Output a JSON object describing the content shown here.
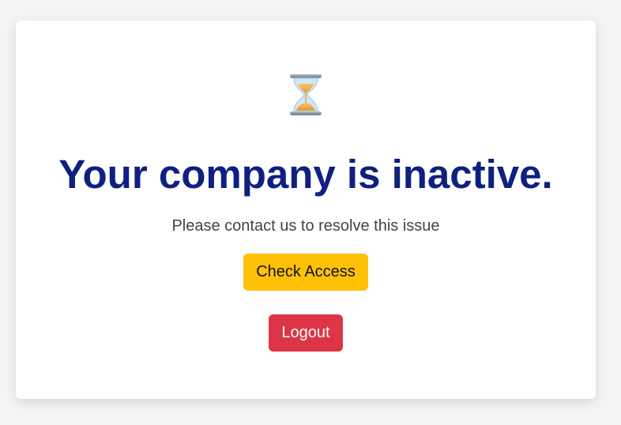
{
  "status": {
    "icon": "hourglass-icon",
    "title": "Your company is inactive.",
    "message": "Please contact us to resolve this issue"
  },
  "actions": {
    "check_access_label": "Check Access",
    "logout_label": "Logout"
  },
  "colors": {
    "title": "#0f2080",
    "message": "#444444",
    "check_access_bg": "#ffc107",
    "check_access_text": "#111111",
    "logout_bg": "#dc3545",
    "logout_text": "#ffffff",
    "page_bg": "#f4f4f4",
    "card_bg": "#ffffff"
  }
}
